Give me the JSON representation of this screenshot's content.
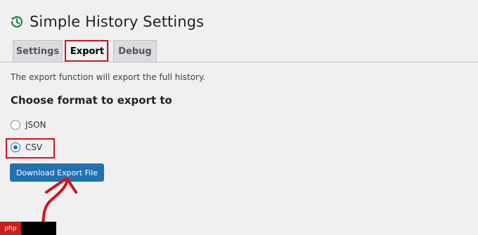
{
  "header": {
    "title": "Simple History Settings",
    "icon": "history-icon"
  },
  "tabs": [
    {
      "label": "Settings",
      "active": false
    },
    {
      "label": "Export",
      "active": true
    },
    {
      "label": "Debug",
      "active": false
    }
  ],
  "export": {
    "description": "The export function will export the full history.",
    "section_title": "Choose format to export to",
    "formats": [
      {
        "label": "JSON",
        "selected": false
      },
      {
        "label": "CSV",
        "selected": true
      }
    ],
    "download_label": "Download Export File"
  },
  "annotations": {
    "highlight_color": "#d4141f",
    "arrow_color": "#d4141f"
  },
  "watermark": {
    "text": "php"
  },
  "colors": {
    "accent": "#2271b1",
    "background": "#f0f0f1",
    "icon_green": "#1b8b3f"
  }
}
